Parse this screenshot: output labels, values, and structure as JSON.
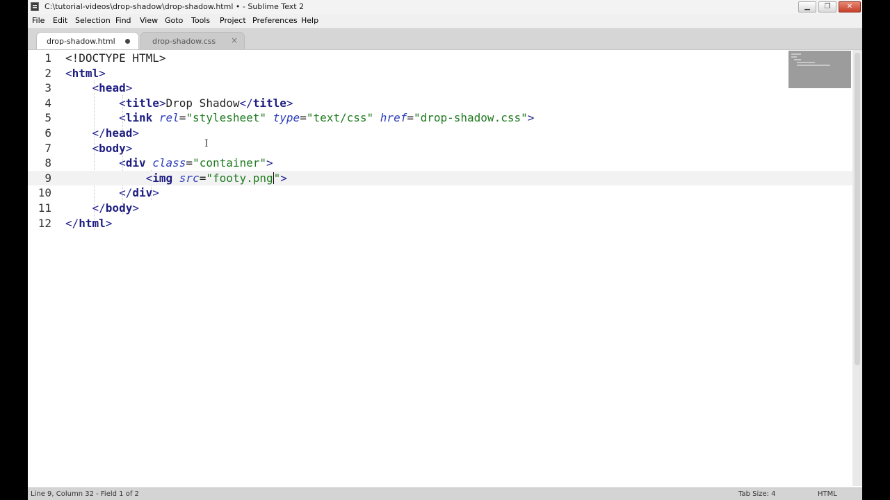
{
  "window": {
    "title": "C:\\tutorial-videos\\drop-shadow\\drop-shadow.html • - Sublime Text 2",
    "min_glyph": "▁",
    "max_glyph": "❐",
    "close_glyph": "✕"
  },
  "menu": [
    "File",
    "Edit",
    "Selection",
    "Find",
    "View",
    "Goto",
    "Tools",
    "Project",
    "Preferences",
    "Help"
  ],
  "tabs": [
    {
      "label": "drop-shadow.html",
      "active": true,
      "dirty": true
    },
    {
      "label": "drop-shadow.css",
      "active": false,
      "close_glyph": "×"
    }
  ],
  "editor": {
    "line_numbers": [
      "1",
      "2",
      "3",
      "4",
      "5",
      "6",
      "7",
      "8",
      "9",
      "10",
      "11",
      "12"
    ],
    "current_line": 9,
    "cursor_glyph": "I",
    "lines": [
      {
        "indent": "",
        "parts": [
          {
            "t": "p",
            "v": "<!DOCTYPE HTML>"
          }
        ]
      },
      {
        "indent": "",
        "parts": [
          {
            "t": "t",
            "v": "<"
          },
          {
            "t": "tn",
            "v": "html"
          },
          {
            "t": "t",
            "v": ">"
          }
        ]
      },
      {
        "indent": "    ",
        "parts": [
          {
            "t": "t",
            "v": "<"
          },
          {
            "t": "tn",
            "v": "head"
          },
          {
            "t": "t",
            "v": ">"
          }
        ]
      },
      {
        "indent": "        ",
        "parts": [
          {
            "t": "t",
            "v": "<"
          },
          {
            "t": "tn",
            "v": "title"
          },
          {
            "t": "t",
            "v": ">"
          },
          {
            "t": "p",
            "v": "Drop Shadow"
          },
          {
            "t": "t",
            "v": "</"
          },
          {
            "t": "tn",
            "v": "title"
          },
          {
            "t": "t",
            "v": ">"
          }
        ]
      },
      {
        "indent": "        ",
        "parts": [
          {
            "t": "t",
            "v": "<"
          },
          {
            "t": "tn",
            "v": "link"
          },
          {
            "t": "p",
            "v": " "
          },
          {
            "t": "a",
            "v": "rel"
          },
          {
            "t": "p",
            "v": "="
          },
          {
            "t": "s",
            "v": "\"stylesheet\""
          },
          {
            "t": "p",
            "v": " "
          },
          {
            "t": "a",
            "v": "type"
          },
          {
            "t": "p",
            "v": "="
          },
          {
            "t": "s",
            "v": "\"text/css\""
          },
          {
            "t": "p",
            "v": " "
          },
          {
            "t": "a",
            "v": "href"
          },
          {
            "t": "p",
            "v": "="
          },
          {
            "t": "s",
            "v": "\"drop-shadow.css\""
          },
          {
            "t": "t",
            "v": ">"
          }
        ]
      },
      {
        "indent": "    ",
        "parts": [
          {
            "t": "t",
            "v": "</"
          },
          {
            "t": "tn",
            "v": "head"
          },
          {
            "t": "t",
            "v": ">"
          }
        ]
      },
      {
        "indent": "    ",
        "parts": [
          {
            "t": "t",
            "v": "<"
          },
          {
            "t": "tn",
            "v": "body"
          },
          {
            "t": "t",
            "v": ">"
          }
        ]
      },
      {
        "indent": "        ",
        "parts": [
          {
            "t": "t",
            "v": "<"
          },
          {
            "t": "tn",
            "v": "div"
          },
          {
            "t": "p",
            "v": " "
          },
          {
            "t": "a",
            "v": "class"
          },
          {
            "t": "p",
            "v": "="
          },
          {
            "t": "s",
            "v": "\"container\""
          },
          {
            "t": "t",
            "v": ">"
          }
        ]
      },
      {
        "indent": "            ",
        "parts": [
          {
            "t": "t",
            "v": "<"
          },
          {
            "t": "tn",
            "v": "img"
          },
          {
            "t": "p",
            "v": " "
          },
          {
            "t": "a",
            "v": "src"
          },
          {
            "t": "p",
            "v": "="
          },
          {
            "t": "s",
            "v": "\"footy.png"
          },
          {
            "t": "caret",
            "v": ""
          },
          {
            "t": "s",
            "v": "\""
          },
          {
            "t": "t",
            "v": ">"
          }
        ]
      },
      {
        "indent": "        ",
        "parts": [
          {
            "t": "t",
            "v": "</"
          },
          {
            "t": "tn",
            "v": "div"
          },
          {
            "t": "t",
            "v": ">"
          }
        ]
      },
      {
        "indent": "    ",
        "parts": [
          {
            "t": "t",
            "v": "</"
          },
          {
            "t": "tn",
            "v": "body"
          },
          {
            "t": "t",
            "v": ">"
          }
        ]
      },
      {
        "indent": "",
        "parts": [
          {
            "t": "t",
            "v": "</"
          },
          {
            "t": "tn",
            "v": "html"
          },
          {
            "t": "t",
            "v": ">"
          }
        ]
      }
    ]
  },
  "status": {
    "left": "Line 9, Column 32 - Field 1 of 2",
    "tab_size": "Tab Size: 4",
    "syntax": "HTML"
  }
}
